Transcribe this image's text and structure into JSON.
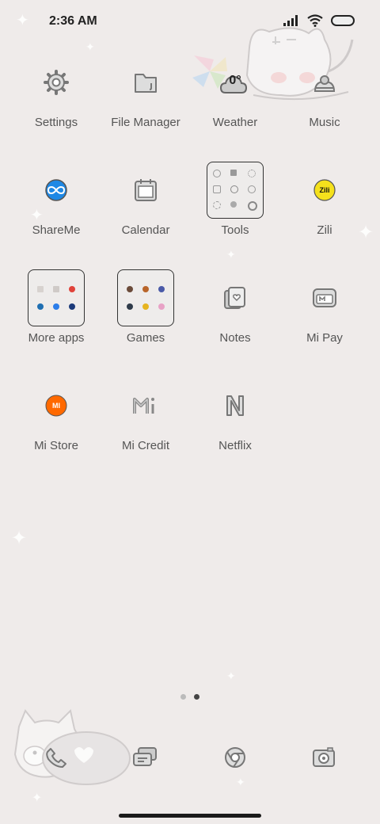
{
  "status_bar": {
    "time": "2:36 AM"
  },
  "apps": [
    {
      "name": "settings",
      "label": "Settings",
      "icon": "gear-icon"
    },
    {
      "name": "file-manager",
      "label": "File Manager",
      "icon": "folder-icon"
    },
    {
      "name": "weather",
      "label": "Weather",
      "icon": "weather-icon",
      "temperature": "0°"
    },
    {
      "name": "music",
      "label": "Music",
      "icon": "music-icon"
    },
    {
      "name": "shareme",
      "label": "ShareMe",
      "icon": "shareme-icon"
    },
    {
      "name": "calendar",
      "label": "Calendar",
      "icon": "calendar-icon"
    },
    {
      "name": "tools",
      "label": "Tools",
      "icon": "folder-tools"
    },
    {
      "name": "zili",
      "label": "Zili",
      "icon": "zili-icon",
      "badge": "Zili"
    },
    {
      "name": "more-apps",
      "label": "More apps",
      "icon": "folder-more-apps"
    },
    {
      "name": "games",
      "label": "Games",
      "icon": "folder-games"
    },
    {
      "name": "notes",
      "label": "Notes",
      "icon": "notes-icon"
    },
    {
      "name": "mi-pay",
      "label": "Mi Pay",
      "icon": "mi-pay-icon"
    },
    {
      "name": "mi-store",
      "label": "Mi Store",
      "icon": "mi-store-icon",
      "badge": "MI"
    },
    {
      "name": "mi-credit",
      "label": "Mi Credit",
      "icon": "mi-credit-icon"
    },
    {
      "name": "netflix",
      "label": "Netflix",
      "icon": "netflix-icon"
    }
  ],
  "dock": [
    {
      "name": "phone",
      "icon": "phone-icon"
    },
    {
      "name": "messages",
      "icon": "messages-icon"
    },
    {
      "name": "browser",
      "icon": "browser-icon"
    },
    {
      "name": "camera",
      "icon": "camera-icon"
    }
  ],
  "page_indicator": {
    "pages": 2,
    "current": 2
  },
  "colors": {
    "background": "#efebea",
    "icon_stroke": "#777777",
    "shareme_blue": "#1e88e5",
    "zili_yellow": "#f5e11c",
    "mi_orange": "#ff6900"
  }
}
